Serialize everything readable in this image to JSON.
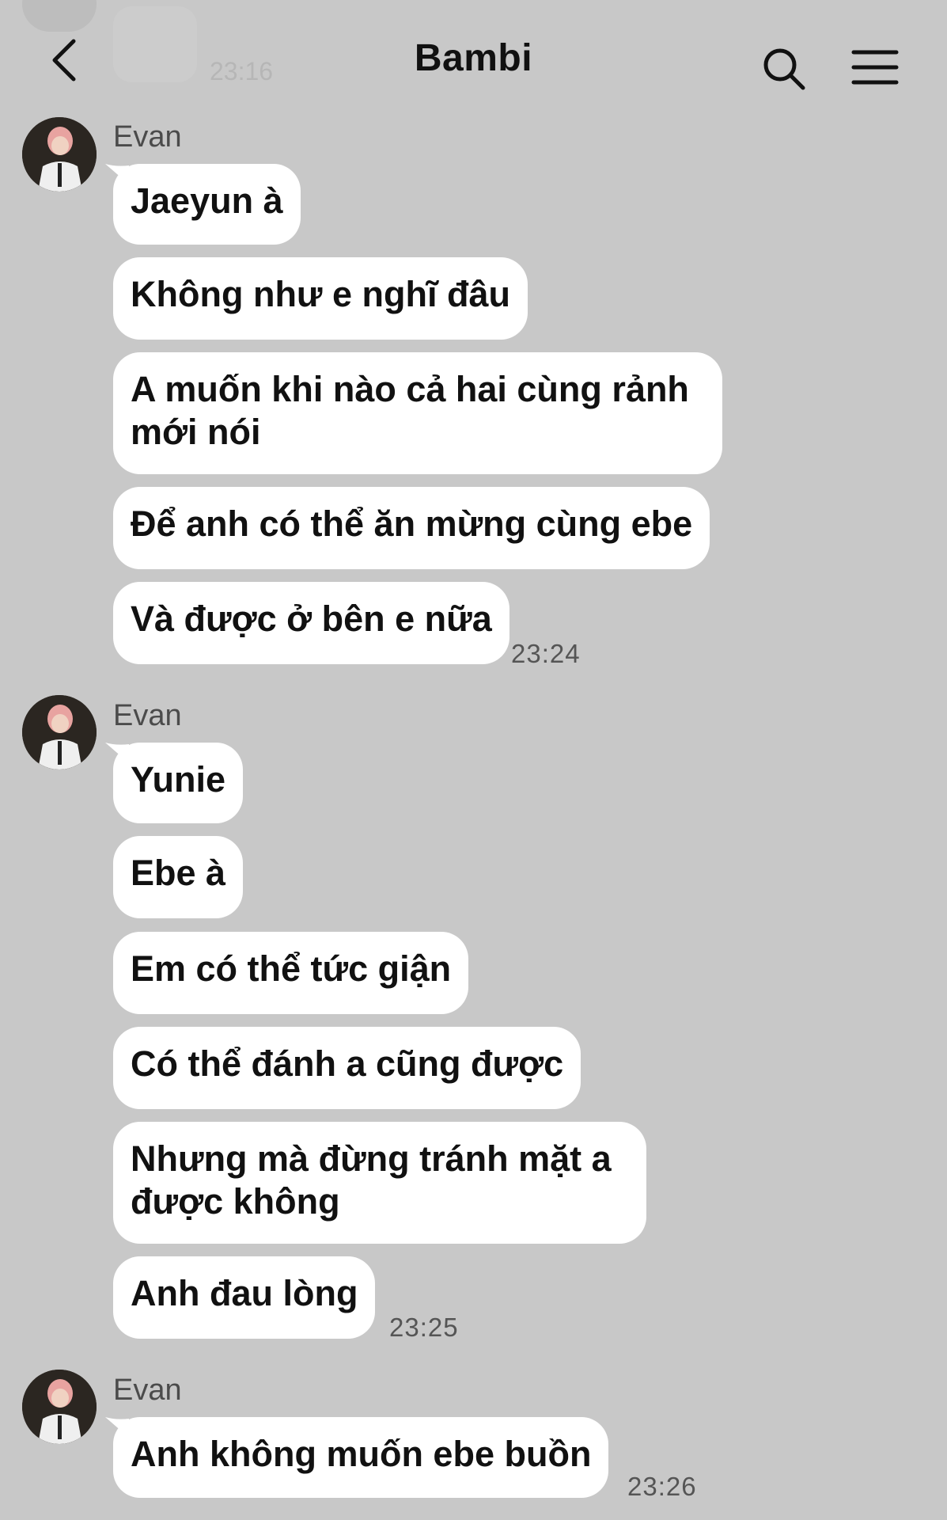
{
  "header": {
    "title": "Bambi",
    "faded_time": "23:16",
    "back_icon": "chevron-left-icon",
    "search_icon": "search-icon",
    "menu_icon": "hamburger-menu-icon"
  },
  "colors": {
    "background": "#c8c8c8",
    "bubble": "#ffffff",
    "text": "#111111",
    "meta": "#555555"
  },
  "groups": [
    {
      "sender": "Evan",
      "messages": [
        "Jaeyun à",
        "Không như e nghĩ đâu",
        "A muốn khi nào cả hai cùng rảnh mới nói",
        "Để anh có thể ăn mừng cùng ebe",
        "Và được ở bên e nữa"
      ],
      "time": "23:24"
    },
    {
      "sender": "Evan",
      "messages": [
        "Yunie",
        "Ebe à",
        "Em có thể tức giận",
        "Có thể đánh a cũng được",
        "Nhưng mà đừng tránh mặt a được không",
        "Anh đau lòng"
      ],
      "time": "23:25"
    },
    {
      "sender": "Evan",
      "messages": [
        "Anh không muốn ebe buồn"
      ],
      "time": "23:26"
    }
  ]
}
